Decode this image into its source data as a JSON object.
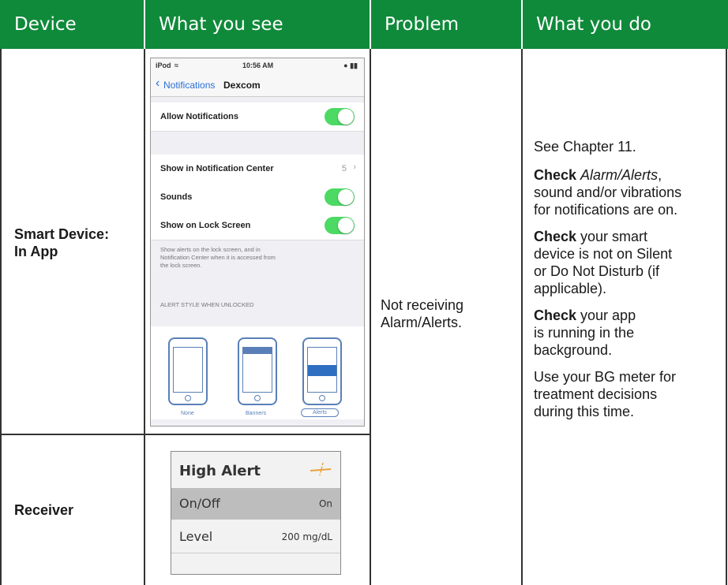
{
  "headers": [
    "Device",
    "What you see",
    "Problem",
    "What you do"
  ],
  "rows": {
    "smart_device": {
      "line1": "Smart Device:",
      "line2": "In App"
    },
    "receiver": {
      "label": "Receiver"
    }
  },
  "problem": {
    "line1": "Not receiving",
    "line2": "Alarm/Alerts."
  },
  "actions": {
    "p1": "See Chapter 11.",
    "p2_bold": "Check",
    "p2_italic": "Alarm/Alerts",
    "p2_rest1": ",",
    "p2_l2": "sound and/or vibrations",
    "p2_l3": "for notifications are on.",
    "p3_bold": "Check",
    "p3_rest": " your smart",
    "p3_l2": "device is not on Silent",
    "p3_l3": "or Do Not Disturb (if",
    "p3_l4": "applicable).",
    "p4_bold": "Check",
    "p4_rest": " your app",
    "p4_l2": "is running in the",
    "p4_l3": "background.",
    "p5_l1": "Use your BG meter for",
    "p5_l2": "treatment decisions",
    "p5_l3": "during this time."
  },
  "phone": {
    "carrier": "iPod",
    "time": "10:56 AM",
    "back": "Notifications",
    "title": "Dexcom",
    "allow": "Allow Notifications",
    "show_center": "Show in Notification Center",
    "show_center_value": "5",
    "sounds": "Sounds",
    "lock": "Show on Lock Screen",
    "note1": "Show alerts on the lock screen, and in",
    "note2": "Notification Center when it is accessed from",
    "note3": "the lock screen.",
    "style_header": "ALERT STYLE WHEN UNLOCKED",
    "styles": [
      "None",
      "Banners",
      "Alerts"
    ]
  },
  "receiver_screen": {
    "title": "High Alert",
    "onoff_label": "On/Off",
    "onoff_value": "On",
    "level_label": "Level",
    "level_value": "200 mg/dL"
  },
  "colors": {
    "header_bg": "#0f8a3a",
    "toggle_on": "#4cd964",
    "ios_blue": "#5a7fb8",
    "receiver_icon": "#e8a23a"
  }
}
